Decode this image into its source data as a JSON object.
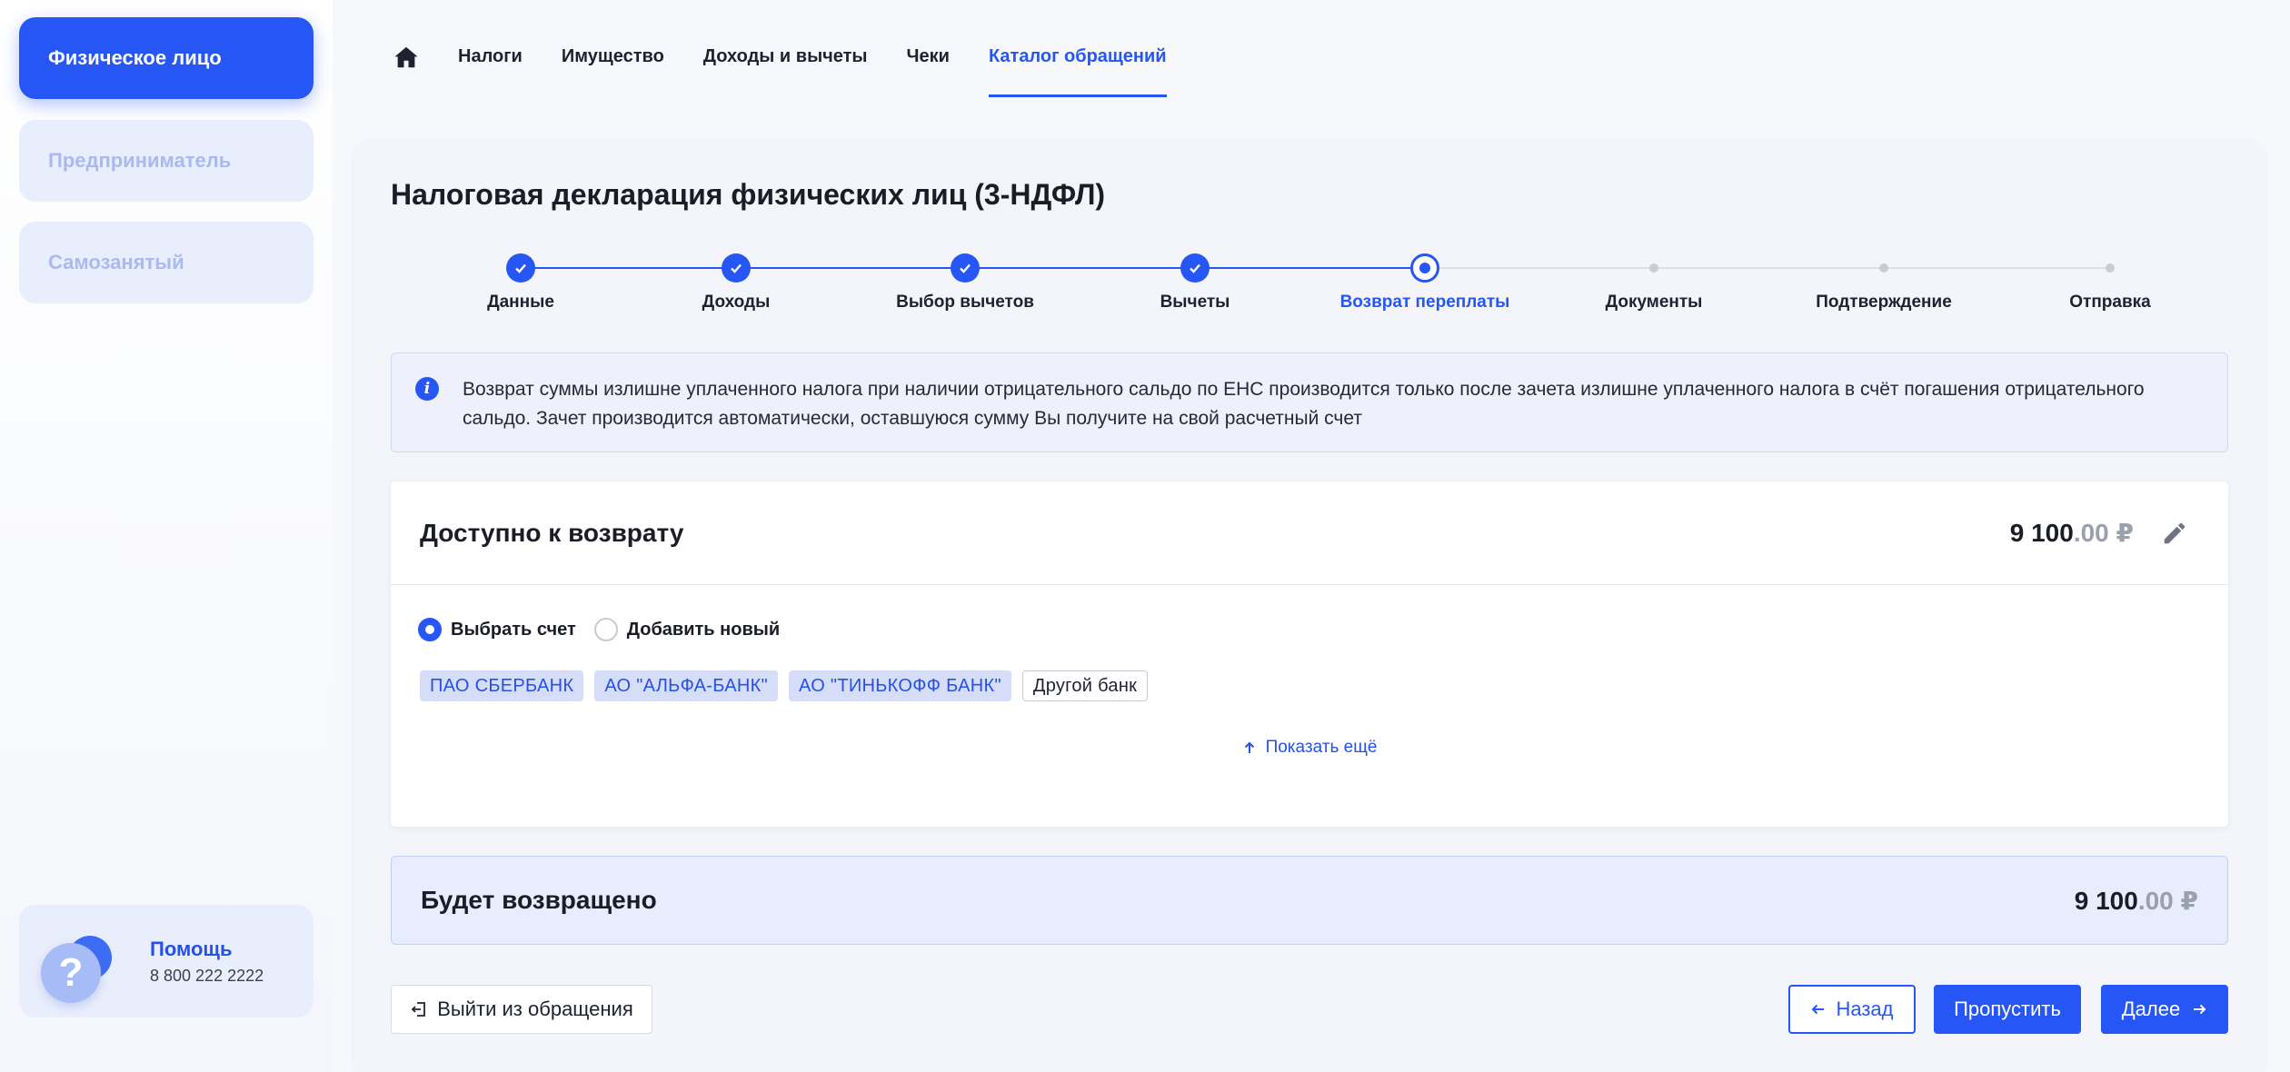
{
  "sidebar": {
    "items": [
      {
        "label": "Физическое лицо"
      },
      {
        "label": "Предприниматель"
      },
      {
        "label": "Самозанятый"
      }
    ],
    "help": {
      "title": "Помощь",
      "phone": "8 800 222 2222",
      "icon_glyph": "?"
    }
  },
  "nav": {
    "items": [
      {
        "label": "Налоги"
      },
      {
        "label": "Имущество"
      },
      {
        "label": "Доходы и вычеты"
      },
      {
        "label": "Чеки"
      },
      {
        "label": "Каталог обращений"
      }
    ],
    "active_index": 4
  },
  "page": {
    "title": "Налоговая декларация физических лиц (3-НДФЛ)"
  },
  "stepper": {
    "steps": [
      {
        "label": "Данные",
        "status": "done"
      },
      {
        "label": "Доходы",
        "status": "done"
      },
      {
        "label": "Выбор вычетов",
        "status": "done"
      },
      {
        "label": "Вычеты",
        "status": "done"
      },
      {
        "label": "Возврат переплаты",
        "status": "current"
      },
      {
        "label": "Документы",
        "status": "pending"
      },
      {
        "label": "Подтверждение",
        "status": "pending"
      },
      {
        "label": "Отправка",
        "status": "pending"
      }
    ]
  },
  "info": {
    "icon_glyph": "i",
    "text": "Возврат суммы излишне уплаченного налога при наличии отрицательного сальдо по ЕНС производится только после зачета излишне уплаченного налога в счёт погашения отрицательного сальдо. Зачет производится автоматически, оставшуюся сумму Вы получите на свой расчетный счет"
  },
  "refund_card": {
    "title": "Доступно к возврату",
    "amount_main": "9 100",
    "amount_cents": ".00 ₽",
    "radios": [
      {
        "label": "Выбрать счет",
        "checked": true
      },
      {
        "label": "Добавить новый",
        "checked": false
      }
    ],
    "banks": [
      "ПАО СБЕРБАНК",
      "АО \"АЛЬФА-БАНК\"",
      "АО \"ТИНЬКОФФ БАНК\""
    ],
    "other_bank": "Другой банк",
    "show_more": "Показать ещё"
  },
  "result": {
    "title": "Будет возвращено",
    "amount_main": "9 100",
    "amount_cents": ".00 ₽"
  },
  "footer": {
    "exit": "Выйти из обращения",
    "back": "Назад",
    "skip": "Пропустить",
    "next": "Далее"
  },
  "colors": {
    "accent": "#2656f5",
    "inactive_sidebar": "#e9eefc",
    "background": "#f7f8fb"
  }
}
